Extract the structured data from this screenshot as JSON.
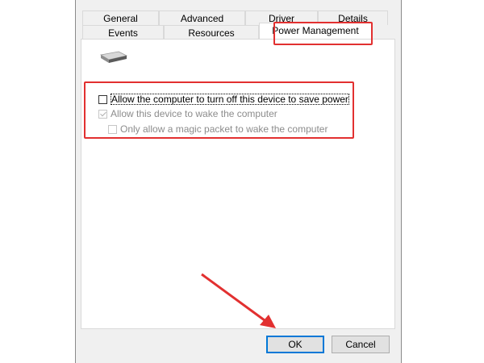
{
  "tabs_row1": [
    "General",
    "Advanced",
    "Driver",
    "Details"
  ],
  "tabs_row2": [
    "Events",
    "Resources",
    "Power Management"
  ],
  "active_tab": "Power Management",
  "device_icon": "network-adapter-icon",
  "options": [
    {
      "label": "Allow the computer to turn off this device to save power",
      "checked": false,
      "enabled": true
    },
    {
      "label": "Allow this device to wake the computer",
      "checked": true,
      "enabled": false
    },
    {
      "label": "Only allow a magic packet to wake the computer",
      "checked": false,
      "enabled": false
    }
  ],
  "buttons": {
    "ok": "OK",
    "cancel": "Cancel"
  },
  "colors": {
    "highlight": "#e23030",
    "focus_border": "#0078d7",
    "dialog_bg": "#f0f0f0"
  }
}
